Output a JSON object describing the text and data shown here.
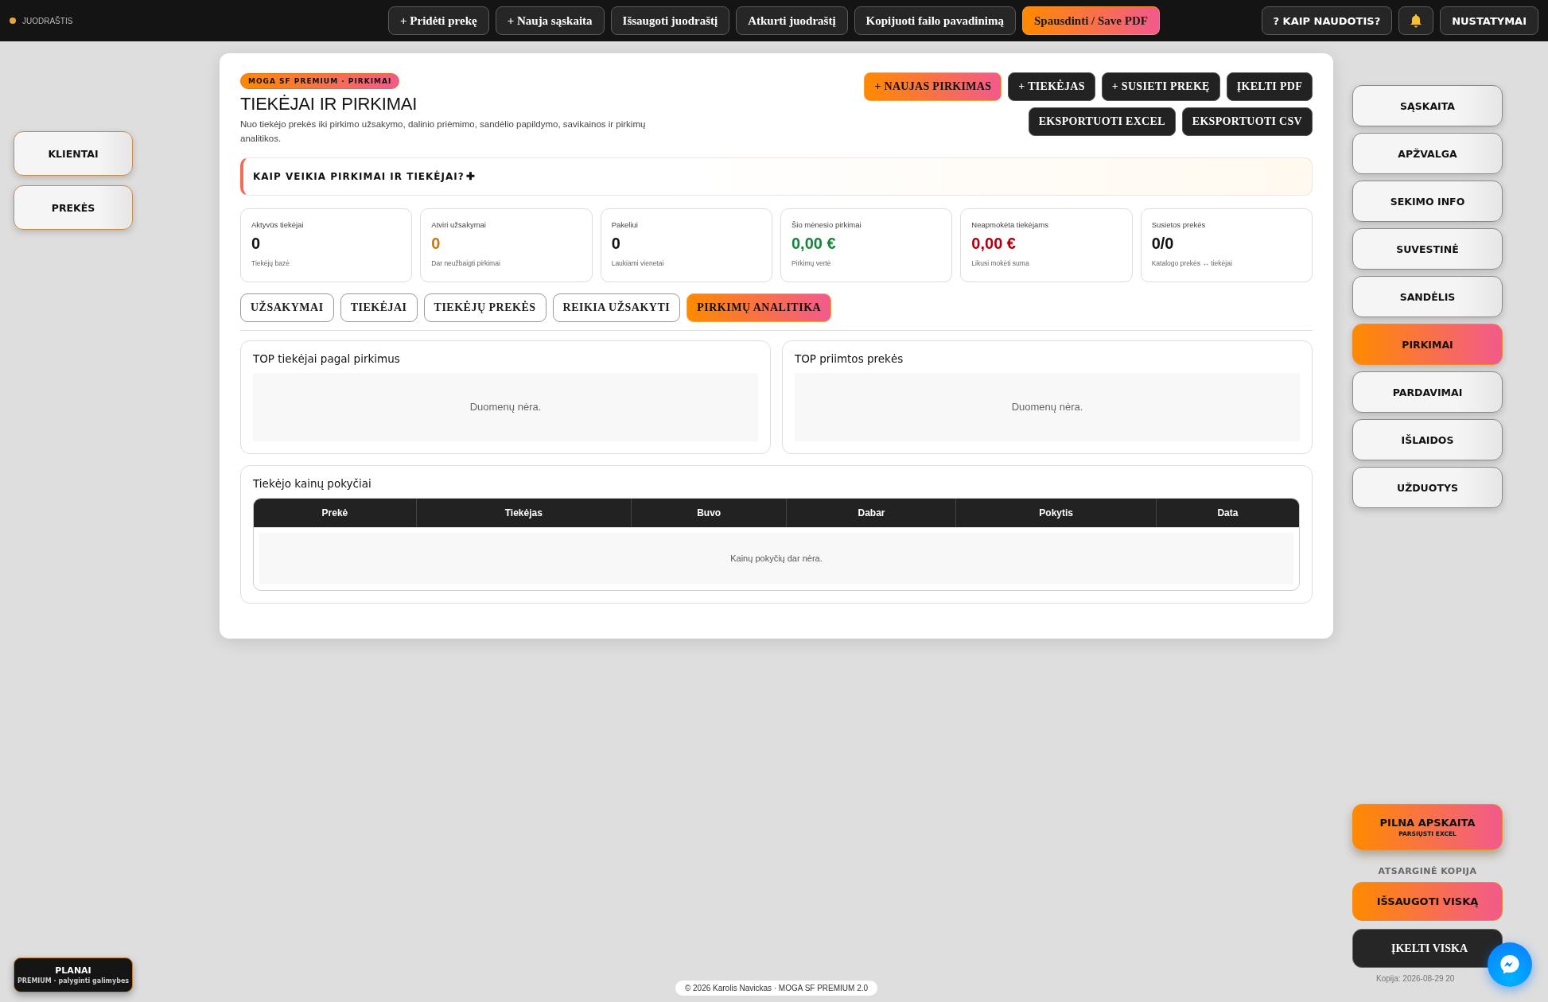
{
  "topbar": {
    "status": {
      "label": "JUODRAŠTIS",
      "color": "#e8a33a"
    },
    "actions": [
      {
        "label": "+ Pridėti prekę",
        "highlighted": false
      },
      {
        "label": "+ Nauja sąskaita",
        "highlighted": false
      },
      {
        "label": "Išsaugoti juodraštį",
        "highlighted": false
      },
      {
        "label": "Atkurti juodraštį",
        "highlighted": false
      },
      {
        "label": "Kopijuoti failo pavadinimą",
        "highlighted": false
      },
      {
        "label": "Spausdinti / Save PDF",
        "highlighted": true
      }
    ],
    "help": "? KAIP NAUDOTIS?",
    "settings": "NUSTATYMAI"
  },
  "left_nav": [
    "KLIENTAI",
    "PREKĖS"
  ],
  "header": {
    "badge": "MOGA SF PREMIUM · PIRKIMAI",
    "title": "TIEKĖJAI IR PIRKIMAI",
    "description": "Nuo tiekėjo prekės iki pirkimo užsakymo, dalinio priėmimo, sandėlio papildymo, savikainos ir pirkimų analitikos.",
    "actions": [
      {
        "label": "+ NAUJAS PIRKIMAS",
        "highlighted": true
      },
      {
        "label": "+ TIEKĖJAS",
        "highlighted": false
      },
      {
        "label": "+ SUSIETI PREKĘ",
        "highlighted": false
      },
      {
        "label": "ĮKELTI PDF",
        "highlighted": false
      },
      {
        "label": "EKSPORTUOTI EXCEL",
        "highlighted": false
      },
      {
        "label": "EKSPORTUOTI CSV",
        "highlighted": false
      }
    ]
  },
  "info_banner": {
    "label": "KAIP VEIKIA PIRKIMAI IR TIEKĖJAI?",
    "toggle": "✚"
  },
  "stats": [
    {
      "label": "Aktyvūs tiekėjai",
      "value": "0",
      "note": "Tiekėjų bazė",
      "color": "#111111"
    },
    {
      "label": "Atviri užsakymai",
      "value": "0",
      "note": "Dar neužbaigti pirkimai",
      "color": "#c8780a"
    },
    {
      "label": "Pakeliui",
      "value": "0",
      "note": "Laukiami vienetai",
      "color": "#111111"
    },
    {
      "label": "Šio mėnesio pirkimai",
      "value": "0,00 €",
      "note": "Pirkimų vertė",
      "color": "#17863a"
    },
    {
      "label": "Neapmokėta tiekėjams",
      "value": "0,00 €",
      "note": "Likusi mokėti suma",
      "color": "#b0000f"
    },
    {
      "label": "Susietos prekės",
      "value": "0/0",
      "note": "Katalogo prekės ↔ tiekėjai",
      "color": "#111111"
    }
  ],
  "tabs": [
    {
      "label": "UŽSAKYMAI",
      "selected": false
    },
    {
      "label": "TIEKĖJAI",
      "selected": false
    },
    {
      "label": "TIEKĖJŲ PREKĖS",
      "selected": false
    },
    {
      "label": "REIKIA UŽSAKYTI",
      "selected": false
    },
    {
      "label": "PIRKIMŲ ANALITIKA",
      "selected": true
    }
  ],
  "panels": [
    {
      "title": "TOP tiekėjai pagal pirkimus",
      "empty_text": "Duomenų nėra."
    },
    {
      "title": "TOP priimtos prekės",
      "empty_text": "Duomenų nėra."
    }
  ],
  "price_changes": {
    "title": "Tiekėjo kainų pokyčiai",
    "columns": [
      "Prekė",
      "Tiekėjas",
      "Buvo",
      "Dabar",
      "Pokytis",
      "Data"
    ],
    "empty_text": "Kainų pokyčių dar nėra."
  },
  "right_nav": [
    {
      "label": "SĄSKAITA",
      "selected": false
    },
    {
      "label": "APŽVALGA",
      "selected": false
    },
    {
      "label": "SEKIMO INFO",
      "selected": false
    },
    {
      "label": "SUVESTINĖ",
      "selected": false
    },
    {
      "label": "SANDĖLIS",
      "selected": false
    },
    {
      "label": "PIRKIMAI",
      "selected": true
    },
    {
      "label": "PARDAVIMAI",
      "selected": false
    },
    {
      "label": "IŠLAIDOS",
      "selected": false
    },
    {
      "label": "UŽDUOTYS",
      "selected": false
    }
  ],
  "export": {
    "title": "PILNA APSKAITA",
    "subtitle": "PARSIŲSTI EXCEL"
  },
  "backup": {
    "title": "ATSARGINĖ KOPIJA",
    "save": "IŠSAUGOTI VISKĄ",
    "load": "ĮKELTI VISKA",
    "last": "Kopija: 2026-08-29 20"
  },
  "plans": {
    "title": "PLANAI",
    "subtitle": "PREMIUM · palyginti galimybes"
  },
  "footer": "© 2026 Karolis Navickas · MOGA SF PREMIUM 2.0"
}
